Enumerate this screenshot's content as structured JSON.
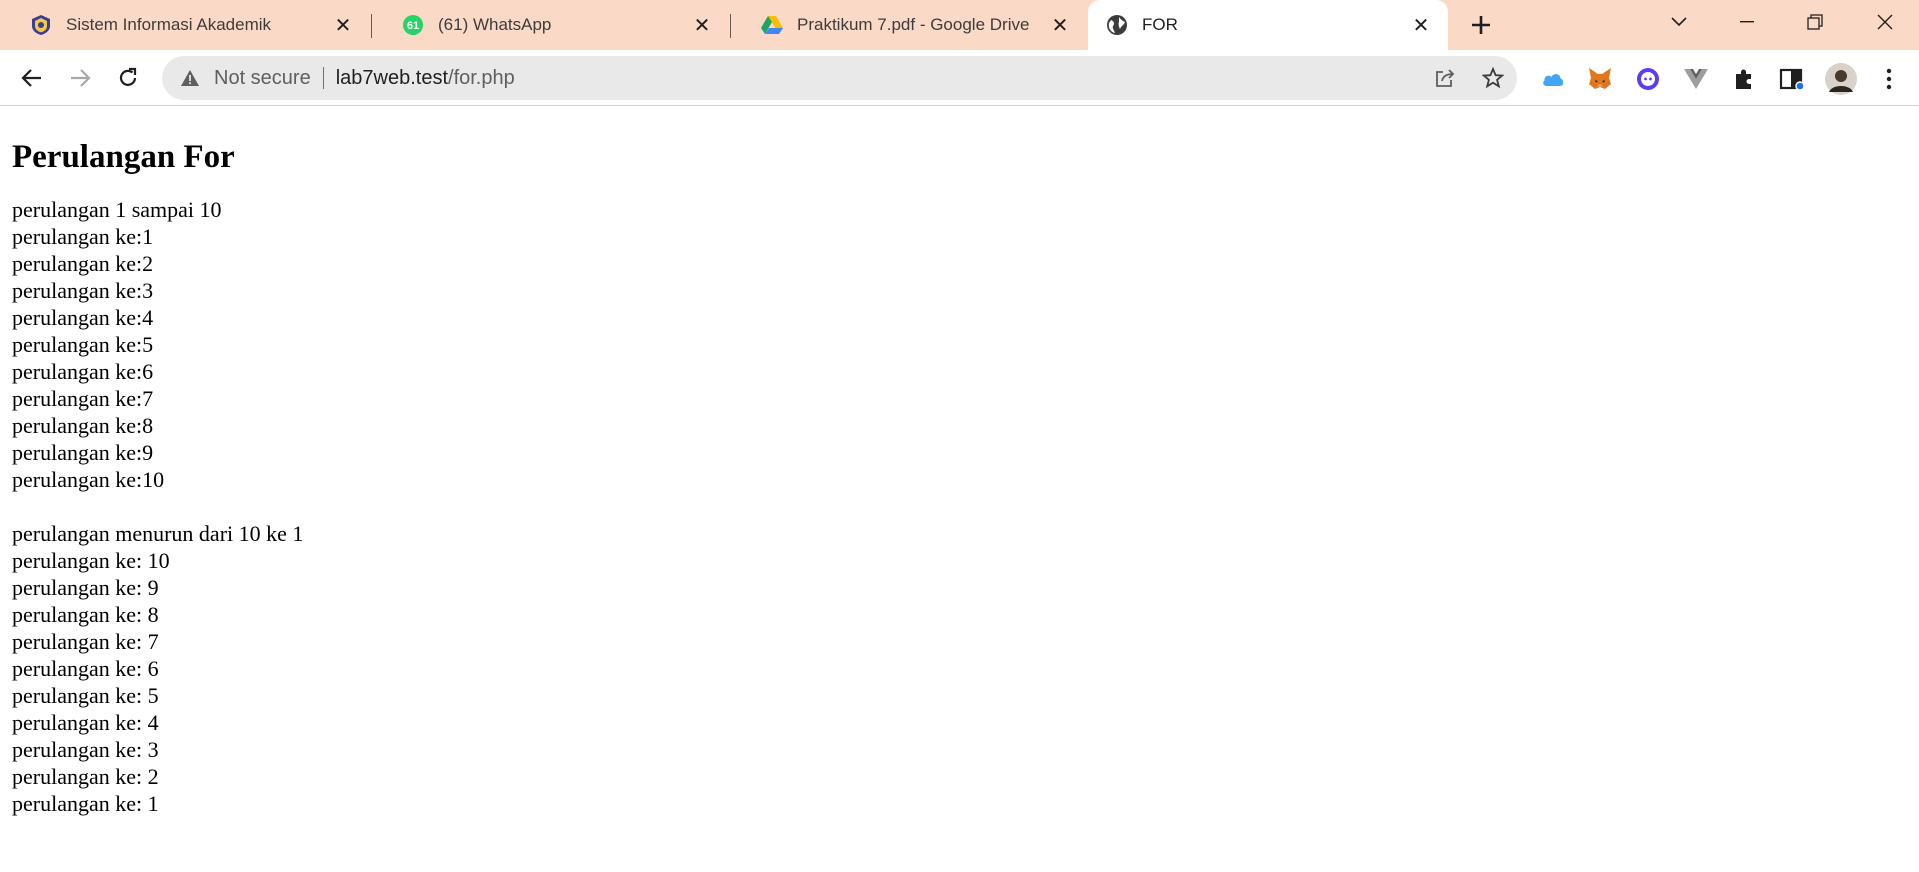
{
  "browser": {
    "tabs": [
      {
        "title": "Sistem Informasi Akademik",
        "icon": "university-crest-icon"
      },
      {
        "title": "(61) WhatsApp",
        "icon": "whatsapp-icon",
        "badge": "61"
      },
      {
        "title": "Praktikum 7.pdf - Google Drive",
        "icon": "google-drive-icon"
      },
      {
        "title": "FOR",
        "icon": "globe-icon",
        "active": true
      }
    ],
    "address_bar": {
      "security_label": "Not secure",
      "url_host": "lab7web.test",
      "url_path": "/for.php"
    },
    "colors": {
      "tabstrip_bg": "#fbd9c7",
      "omnibox_bg": "#e9e9e9"
    }
  },
  "page": {
    "heading": "Perulangan For",
    "ascending": {
      "intro": "perulangan 1 sampai 10",
      "lines": [
        "perulangan ke:1",
        "perulangan ke:2",
        "perulangan ke:3",
        "perulangan ke:4",
        "perulangan ke:5",
        "perulangan ke:6",
        "perulangan ke:7",
        "perulangan ke:8",
        "perulangan ke:9",
        "perulangan ke:10"
      ]
    },
    "descending": {
      "intro": "perulangan menurun dari 10 ke 1",
      "lines": [
        "perulangan ke: 10",
        "perulangan ke: 9",
        "perulangan ke: 8",
        "perulangan ke: 7",
        "perulangan ke: 6",
        "perulangan ke: 5",
        "perulangan ke: 4",
        "perulangan ke: 3",
        "perulangan ke: 2",
        "perulangan ke: 1"
      ]
    }
  }
}
